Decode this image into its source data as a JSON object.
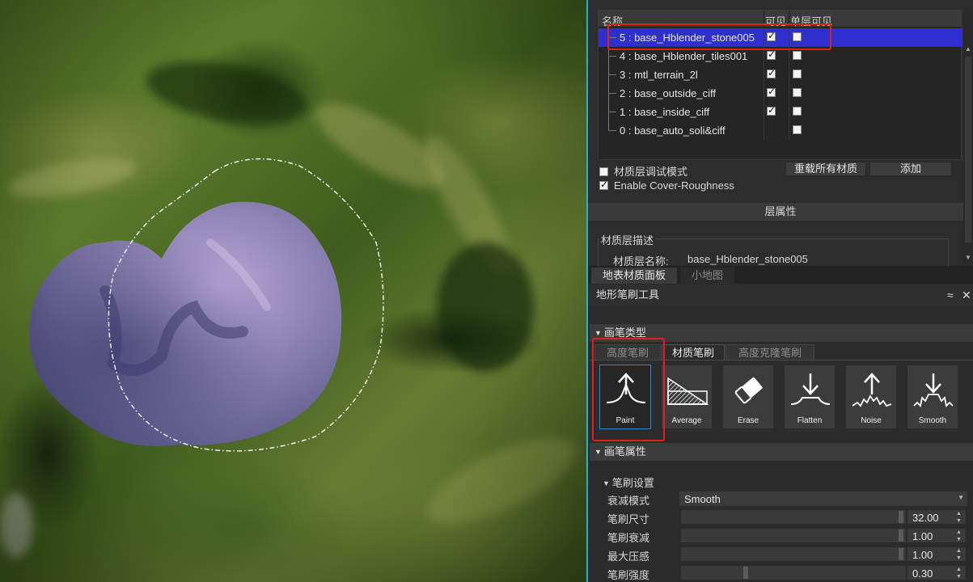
{
  "layer_list": {
    "headers": {
      "name": "名称",
      "visible": "可见",
      "single_visible": "单层可见"
    },
    "rows": [
      {
        "label": "5 : base_Hblender_stone005",
        "visible": true,
        "single": false,
        "selected": true
      },
      {
        "label": "4 : base_Hblender_tiles001",
        "visible": true,
        "single": false,
        "selected": false
      },
      {
        "label": "3 : mtl_terrain_2l",
        "visible": true,
        "single": false,
        "selected": false
      },
      {
        "label": "2 : base_outside_ciff",
        "visible": true,
        "single": false,
        "selected": false
      },
      {
        "label": "1 : base_inside_ciff",
        "visible": true,
        "single": false,
        "selected": false
      },
      {
        "label": "0 : base_auto_soli&ciff",
        "visible": false,
        "single": false,
        "selected": false
      }
    ]
  },
  "options": {
    "debug_mode_label": "材质层调试模式",
    "debug_mode_checked": false,
    "cover_roughness_label": "Enable Cover-Roughness",
    "cover_roughness_checked": true,
    "reload_button": "重载所有材质",
    "add_button": "添加"
  },
  "layer_props": {
    "section_title": "层属性",
    "desc_group": "材质层描述",
    "name_label": "材质层名称:",
    "name_value": "base_Hblender_stone005"
  },
  "dock_tabs": [
    {
      "label": "地表材质面板",
      "active": true
    },
    {
      "label": "小地图",
      "active": false
    }
  ],
  "tool": {
    "title": "地形笔刷工具",
    "pin_glyph": "≈",
    "close_glyph": "✕"
  },
  "brush_type": {
    "group_title": "画笔类型",
    "tabs": [
      {
        "label": "高度笔刷",
        "active": false
      },
      {
        "label": "材质笔刷",
        "active": true
      },
      {
        "label": "高度克隆笔刷",
        "active": false
      }
    ],
    "brushes": [
      {
        "label": "Paint",
        "icon": "paint-icon",
        "active": true
      },
      {
        "label": "Average",
        "icon": "average-icon",
        "active": false
      },
      {
        "label": "Erase",
        "icon": "erase-icon",
        "active": false
      },
      {
        "label": "Flatten",
        "icon": "flatten-icon",
        "active": false
      },
      {
        "label": "Noise",
        "icon": "noise-icon",
        "active": false
      },
      {
        "label": "Smooth",
        "icon": "smooth-icon",
        "active": false
      }
    ]
  },
  "brush_props": {
    "group_title": "画笔属性",
    "settings_title": "笔刷设置",
    "falloff_mode": {
      "label": "衰减模式",
      "value": "Smooth"
    },
    "sliders": [
      {
        "label": "笔刷尺寸",
        "value": "32.00",
        "fraction": 0.99
      },
      {
        "label": "笔刷衰减",
        "value": "1.00",
        "fraction": 0.99
      },
      {
        "label": "最大压感",
        "value": "1.00",
        "fraction": 0.99
      },
      {
        "label": "笔刷强度",
        "value": "0.30",
        "fraction": 0.3
      }
    ]
  },
  "colors": {
    "selection": "#2f2fd0",
    "highlight_box": "#e02020",
    "accent_border": "#1fb5c8"
  }
}
